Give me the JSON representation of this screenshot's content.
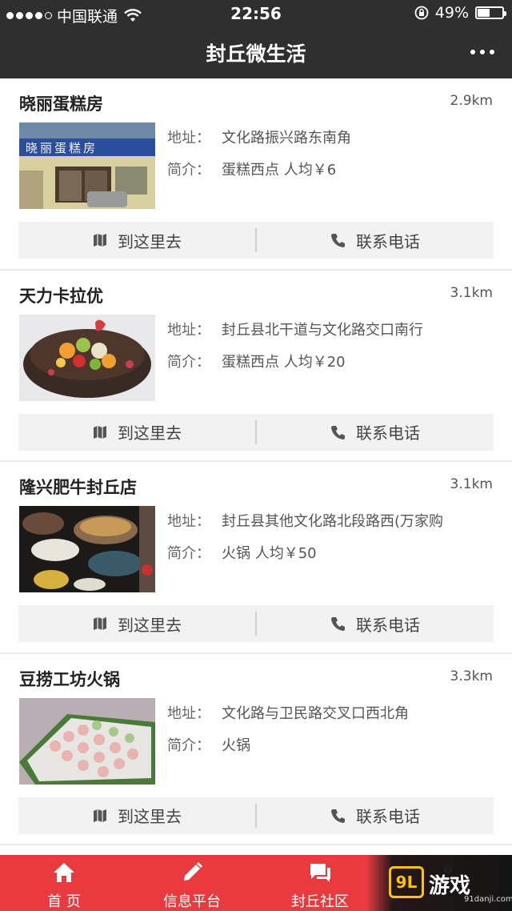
{
  "statusbar": {
    "carrier": "中国联通",
    "time": "22:56",
    "battery": "49%",
    "battery_level": 0.49
  },
  "header": {
    "title": "封丘微生活"
  },
  "labels": {
    "address": "地址：",
    "intro": "简介：",
    "navigate": "到这里去",
    "call": "联系电话"
  },
  "stores": [
    {
      "name": "晓丽蛋糕房",
      "distance": "2.9km",
      "address": "文化路振兴路东南角",
      "intro": "蛋糕西点 人均￥6",
      "image_sign": "晓丽蛋糕房"
    },
    {
      "name": "天力卡拉优",
      "distance": "3.1km",
      "address": "封丘县北干道与文化路交口南行",
      "intro": "蛋糕西点 人均￥20"
    },
    {
      "name": "隆兴肥牛封丘店",
      "distance": "3.1km",
      "address": "封丘县其他文化路北段路西(万家购",
      "intro": "火锅 人均￥50"
    },
    {
      "name": "豆捞工坊火锅",
      "distance": "3.3km",
      "address": "文化路与卫民路交叉口西北角",
      "intro": "火锅"
    }
  ],
  "tabbar": {
    "items": [
      {
        "label": "首 页",
        "icon": "home-icon"
      },
      {
        "label": "信息平台",
        "icon": "pencil-icon"
      },
      {
        "label": "封丘社区",
        "icon": "chat-icon"
      },
      {
        "label": "",
        "icon": "user-icon"
      }
    ]
  },
  "watermark": {
    "text": "游戏",
    "badge": "9L",
    "domain": "91danji.com"
  },
  "colors": {
    "header_bg": "#2f2f2f",
    "tabbar_bg": "#e83a3f",
    "action_bg": "#f2f2f2"
  }
}
